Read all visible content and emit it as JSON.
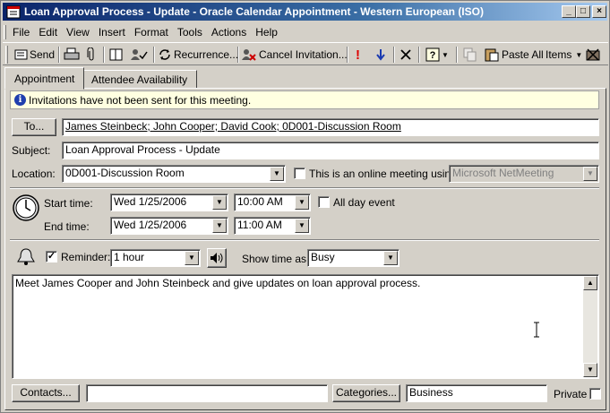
{
  "window": {
    "title": "Loan Approval Process - Update - Oracle Calendar Appointment  - Western European (ISO)",
    "controls": {
      "minimize": "_",
      "maximize": "□",
      "close": "×"
    }
  },
  "menu": [
    "File",
    "Edit",
    "View",
    "Insert",
    "Format",
    "Tools",
    "Actions",
    "Help"
  ],
  "toolbar": {
    "send": "Send",
    "recurrence": "Recurrence...",
    "cancel_invitation": "Cancel Invitation...",
    "paste_all": "Paste All",
    "items": "Items"
  },
  "tabs": [
    "Appointment",
    "Attendee Availability"
  ],
  "info": "Invitations have not been sent for this meeting.",
  "to": {
    "button": "To...",
    "value": "James Steinbeck; John Cooper; David Cook; 0D001-Discussion Room"
  },
  "subject": {
    "label": "Subject:",
    "value": "Loan Approval Process - Update"
  },
  "location": {
    "label": "Location:",
    "value": "0D001-Discussion Room",
    "online_label": "This is an online meeting using:",
    "online_value": "Microsoft NetMeeting"
  },
  "start": {
    "label": "Start time:",
    "date": "Wed 1/25/2006",
    "time": "10:00 AM"
  },
  "end": {
    "label": "End time:",
    "date": "Wed 1/25/2006",
    "time": "11:00 AM"
  },
  "all_day": "All day event",
  "reminder": {
    "label": "Reminder:",
    "value": "1 hour",
    "checked": true
  },
  "show_time": {
    "label": "Show time as:",
    "value": "Busy"
  },
  "notes": "Meet James Cooper  and John Steinbeck and give updates on loan approval process.",
  "footer": {
    "contacts_button": "Contacts...",
    "contacts_value": "",
    "categories_button": "Categories...",
    "categories_value": "Business",
    "private_label": "Private"
  }
}
